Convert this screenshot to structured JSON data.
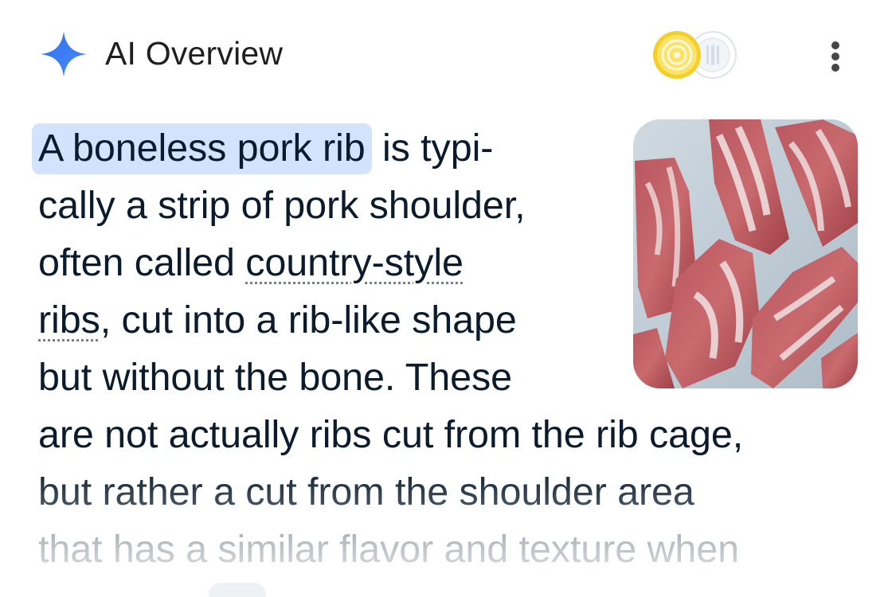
{
  "header": {
    "title": "AI Overview",
    "sparkle_icon": "sparkle-icon",
    "source_icons": [
      "lemon-swirl-icon",
      "fork-knife-icon"
    ],
    "menu_icon": "more-vert-icon"
  },
  "answer": {
    "highlight": "A boneless pork rib",
    "line1_rest": "is typi-",
    "line2": "cally a strip of pork shoulder,",
    "line3_pre": "often called ",
    "link1": "country-style",
    "link2": "ribs",
    "line4_rest": ", cut into a rib-like shape",
    "line5": "but without the bone. These",
    "line6": "are not actually ribs cut from the rib cage,",
    "line7": "but rather a cut from the shoulder area",
    "line8": "that has a similar flavor and texture when"
  },
  "colors": {
    "accent_blue": "#4285f4",
    "highlight_bg": "#d3e3fd",
    "text": "#0a1b2d",
    "icon_yellow": "#f7d530"
  }
}
